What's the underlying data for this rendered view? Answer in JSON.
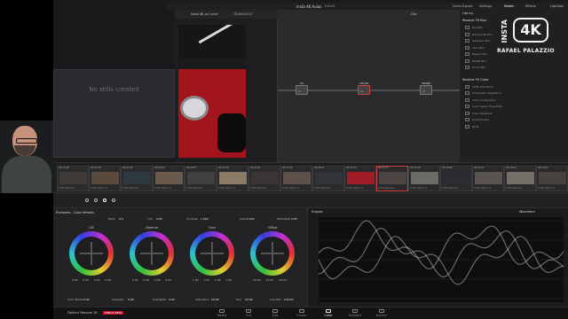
{
  "project": {
    "title": "Insta 4K Aulas",
    "status": "Edited"
  },
  "topbar": {
    "quick_export": "Quick Export",
    "settings": "Settings",
    "nodes": "Nodes",
    "effects": "Effects",
    "lightbox": "Lightbox"
  },
  "viewer": {
    "clip_name": "Insta 4K_ia Curve",
    "timecode_top": "01:00:15:17",
    "timecode": "01:00:32:06",
    "clip_mode": "Clip"
  },
  "stills": {
    "empty_text": "No stills created"
  },
  "nodes": [
    {
      "label": "01",
      "num": "01"
    },
    {
      "label": "COLOR",
      "num": "02"
    },
    {
      "label": "SHARP",
      "num": "03"
    }
  ],
  "library": {
    "tab": "Library",
    "section1": "Resolve FX Blur",
    "items1": [
      "Box Blur",
      "Directional Blur",
      "Gaussian Blur",
      "Lens Blur",
      "Mosaic Blur",
      "Radial Blur",
      "Zoom Blur"
    ],
    "section2": "Resolve FX Color",
    "items2": [
      "ACES Transform",
      "Chromatic Adaptation",
      "Color Compressor",
      "Color Space Transform",
      "Color Stabilizer",
      "Contrast Pop",
      "DCTL"
    ]
  },
  "logo": {
    "vertical": "INSTA",
    "mark": "4K",
    "name": "RAFAEL PALAZZIO"
  },
  "timeline": {
    "clips": [
      {
        "num": "01",
        "tc": "00:11:08",
        "name": "H.264 High L5.1"
      },
      {
        "num": "02",
        "tc": "00:22:18",
        "name": "H.264 High L5.1"
      },
      {
        "num": "03",
        "tc": "00:41:06",
        "name": "H.264 High L5.1"
      },
      {
        "num": "04",
        "tc": "00:50:04",
        "name": "H.264 High L5.1"
      },
      {
        "num": "05",
        "tc": "00:09:07",
        "name": "H.264 High L5.1"
      },
      {
        "num": "06",
        "tc": "00:12:19",
        "name": "H.264 High L5.1"
      },
      {
        "num": "07",
        "tc": "00:03:21",
        "name": "H.264 High L5.1"
      },
      {
        "num": "08",
        "tc": "00:14:20",
        "name": "H.264 High L5.1"
      },
      {
        "num": "09",
        "tc": "00:08:21",
        "name": "H.264 High L5.1"
      },
      {
        "num": "10",
        "tc": "00:53:23",
        "name": "H.264 High L5.1"
      },
      {
        "num": "11",
        "tc": "00:12:17",
        "name": "H.264 High L5.1"
      },
      {
        "num": "12",
        "tc": "00:42:08",
        "name": "H.264 High L5.1"
      },
      {
        "num": "13",
        "tc": "00:16:06",
        "name": "H.264 High L5.1"
      },
      {
        "num": "14",
        "tc": "00:05:21",
        "name": "H.264 High L5.1"
      },
      {
        "num": "15",
        "tc": "00:18:04",
        "name": "H.264 High L5.1"
      },
      {
        "num": "16",
        "tc": "00:10:02",
        "name": "H.264 High L5.1"
      }
    ]
  },
  "primaries": {
    "title": "Primaries - Color Wheels",
    "temp_label": "Temp",
    "temp": "0.0",
    "tint_label": "Tint",
    "tint": "0.00",
    "contrast_label": "Contrast",
    "contrast": "1.000",
    "pivot_label": "Pivot",
    "pivot": "0.435",
    "middetail_label": "Mid/Detail",
    "middetail": "0.00",
    "wheels": [
      {
        "name": "Lift",
        "vals": [
          "0.00",
          "0.00",
          "0.00",
          "0.00"
        ]
      },
      {
        "name": "Gamma",
        "vals": [
          "0.00",
          "0.00",
          "0.00",
          "0.00"
        ]
      },
      {
        "name": "Gain",
        "vals": [
          "1.00",
          "1.00",
          "1.00",
          "1.00"
        ]
      },
      {
        "name": "Offset",
        "vals": [
          "25.00",
          "25.00",
          "25.00",
          ""
        ]
      }
    ],
    "color_boost_label": "Color Boost",
    "color_boost": "0.00",
    "shadows_label": "Shadows",
    "shadows": "0.00",
    "highlights_label": "Highlights",
    "highlights": "0.00",
    "saturation_label": "Saturation",
    "saturation": "50.00",
    "hue_label": "Hue",
    "hue": "50.00",
    "lum_mix_label": "Lum Mix",
    "lum_mix": "100.00"
  },
  "scopes": {
    "title": "Scopes",
    "mode": "Waveform"
  },
  "pages": [
    "Media",
    "Cut",
    "Edit",
    "Fusion",
    "Color",
    "Fairlight",
    "Deliver"
  ],
  "active_page": "Color",
  "app": {
    "name": "DaVinci Resolve 18",
    "badge": "PUBLIC BETA"
  },
  "accent": "#c8102e"
}
